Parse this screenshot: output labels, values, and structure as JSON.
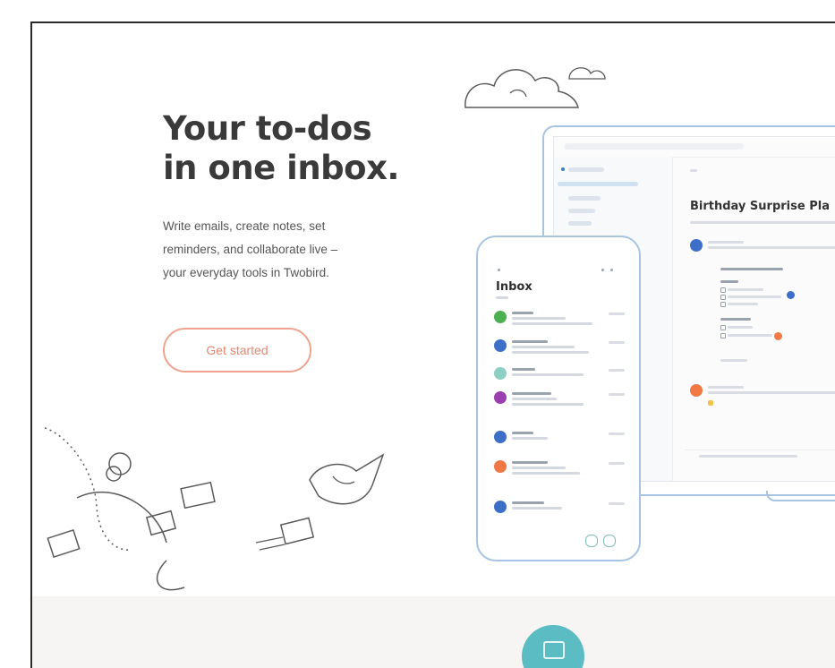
{
  "hero": {
    "title_line1": "Your to-dos",
    "title_line2": "in one inbox.",
    "subtitle_line1": "Write emails, create notes, set",
    "subtitle_line2": "reminders, and collaborate live –",
    "subtitle_line3": "your everyday tools in Twobird.",
    "cta_label": "Get started"
  },
  "phone": {
    "inbox_title": "Inbox",
    "avatars": [
      "#4caf50",
      "#3d6fc9",
      "#8ecfc3",
      "#9b3fb0",
      "#3d6fc9",
      "#f07845",
      "#3d6fc9"
    ]
  },
  "laptop": {
    "note_title": "Birthday Surprise Pla",
    "avatars": [
      "#3d6fc9",
      "#f07845"
    ],
    "pin_colors": [
      "#3d6fc9",
      "#f07845"
    ]
  },
  "colors": {
    "accent": "#e9866e",
    "device_outline": "#a7c5e2",
    "badge": "#5bbcc4"
  },
  "icons": {
    "badge": "app-icon",
    "clouds": "cloud-doodle",
    "doodles": "paper-plane-doodle"
  }
}
